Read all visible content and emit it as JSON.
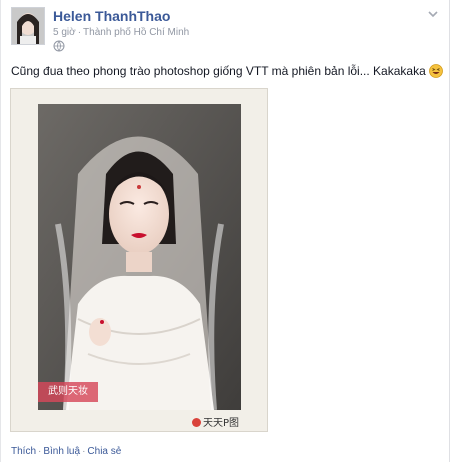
{
  "post": {
    "author": "Helen ThanhThao",
    "time": "5 giờ",
    "separator": "·",
    "location": "Thành phố Hồ Chí Minh",
    "message": "Cũng đua theo phong trào photoshop giống VTT mà phiên bản lỗi... Kakakaka",
    "emoji": "grinning-squint-face-emoji",
    "privacy_icon": "globe-icon",
    "menu_icon": "chevron-down-icon"
  },
  "photo": {
    "watermark_banner": "武则天妆",
    "watermark_logo": "天天P图"
  },
  "actions": {
    "like": "Thích",
    "comment": "Bình luậ",
    "share": "Chia sẻ",
    "separator": "·"
  },
  "colors": {
    "link": "#3b5998",
    "meta": "#9197a3",
    "text": "#141823",
    "banner": "#d6485a"
  }
}
